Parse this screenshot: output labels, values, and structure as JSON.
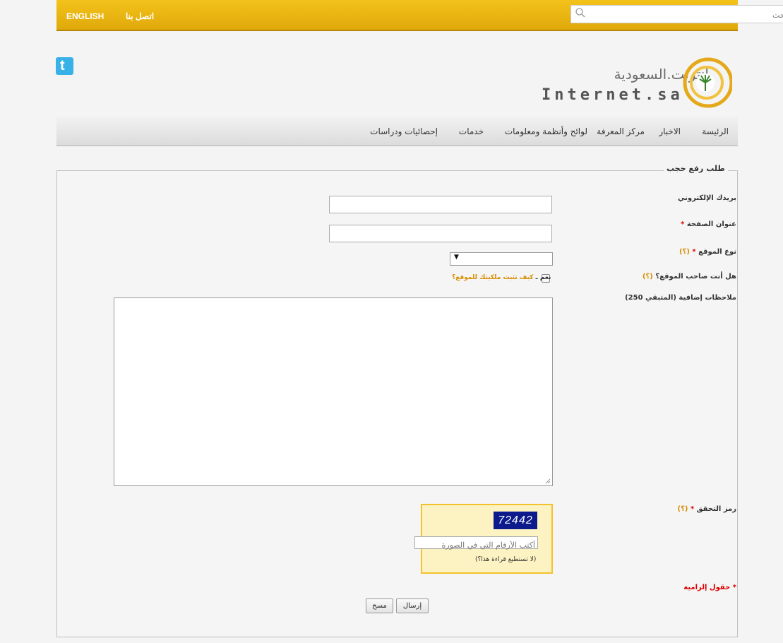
{
  "topbar": {
    "english": "ENGLISH",
    "contact": "اتصل بنا",
    "search_placeholder": "بحث"
  },
  "logo": {
    "arabic": "انترنت.السعودية",
    "english": "Internet.sa"
  },
  "social": {
    "twitter_glyph": "t"
  },
  "nav": [
    "الرئيسة",
    "الاخبار",
    "مركز المعرفة",
    "لوائح وأنظمة ومعلومات",
    "خدمات",
    "إحصائيات ودراسات"
  ],
  "form": {
    "legend": "طلب رفع حجب",
    "email_label": "بريدك الإلكتروني",
    "page_address_label": "عنوان الصفحة",
    "site_type_label": "نوع الموقع",
    "owner_label": "هل أنت صاحب الموقع؟",
    "owner_yes": "نعم ـ",
    "owner_how": "كيف تثبت ملكيتك للموقع؟",
    "notes_label": "ملاحظات إضافية (المتبقي 250)",
    "captcha_label": "رمز التحقق",
    "captcha_code": "72442",
    "captcha_placeholder": "أكتب الأرقام التي في الصورة",
    "captcha_help": "(لا تستطيع قراءة هذا؟)",
    "required_note": "حقول إلزامية",
    "required_marker": "*",
    "help_marker": "(؟)",
    "submit": "إرسال",
    "clear": "مسح"
  },
  "colors": {
    "topbar": "#e6b00f",
    "required": "#dd0000",
    "help": "#d98b00",
    "captcha_bg": "#fdf3c2"
  }
}
